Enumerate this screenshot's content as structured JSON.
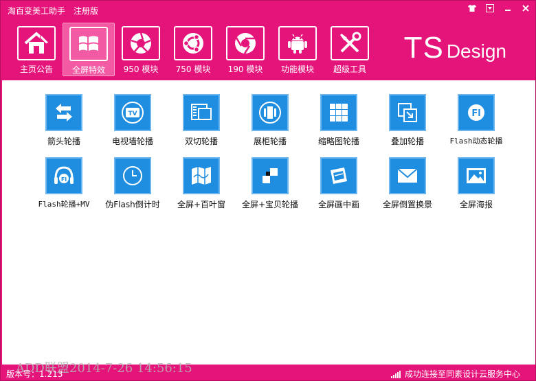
{
  "app": {
    "title": "淘百变美工助手",
    "edition": "注册版"
  },
  "window_buttons": [
    {
      "name": "skin-icon"
    },
    {
      "name": "menu-icon"
    },
    {
      "name": "minimize-icon"
    },
    {
      "name": "close-icon"
    }
  ],
  "toolbar": {
    "items": [
      {
        "label": "主页公告",
        "icon": "home-icon",
        "active": false
      },
      {
        "label": "全屏特效",
        "icon": "windows-icon",
        "active": true
      },
      {
        "label": "950 模块",
        "icon": "aperture-icon",
        "active": false
      },
      {
        "label": "750 模块",
        "icon": "ubuntu-icon",
        "active": false
      },
      {
        "label": "190 模块",
        "icon": "chrome-icon",
        "active": false
      },
      {
        "label": "功能模块",
        "icon": "android-icon",
        "active": false
      },
      {
        "label": "超级工具",
        "icon": "tools-icon",
        "active": false
      }
    ]
  },
  "brand": {
    "main": "TS",
    "sub": "Design"
  },
  "effects": [
    {
      "label": "箭头轮播",
      "icon": "arrows-icon"
    },
    {
      "label": "电视墙轮播",
      "icon": "tv-icon"
    },
    {
      "label": "双切轮播",
      "icon": "dual-switch-icon"
    },
    {
      "label": "展柜轮播",
      "icon": "showcase-icon"
    },
    {
      "label": "缩略图轮播",
      "icon": "thumbnail-grid-icon"
    },
    {
      "label": "叠加轮播",
      "icon": "overlay-icon"
    },
    {
      "label": "Flash动态轮播",
      "icon": "flash-icon"
    },
    {
      "label": "Flash轮播+MV",
      "icon": "flash-headphones-icon"
    },
    {
      "label": "伪Flash倒计时",
      "icon": "clock-icon"
    },
    {
      "label": "全屏+百叶窗",
      "icon": "map-fold-icon"
    },
    {
      "label": "全屏+宝贝轮播",
      "icon": "checker-icon"
    },
    {
      "label": "全屏画中画",
      "icon": "picture-in-picture-icon"
    },
    {
      "label": "全屏倒置换景",
      "icon": "envelope-icon"
    },
    {
      "label": "全屏海报",
      "icon": "image-icon"
    }
  ],
  "watermark": "ADD联盟2014-7-26 14:56:15",
  "status": {
    "version": "版本号：1.213",
    "connection": "成功连接至同素设计云服务中心"
  },
  "colors": {
    "chrome": "#e4147a",
    "tile": "#1f8de0",
    "content_bg": "#ffffff"
  }
}
